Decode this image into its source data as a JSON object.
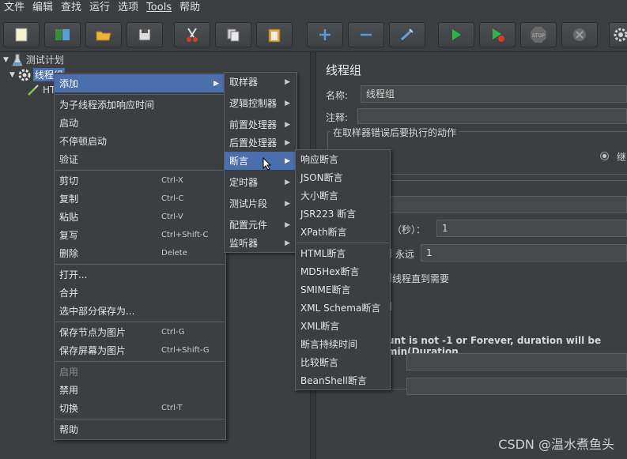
{
  "menubar": [
    "文件",
    "编辑",
    "查找",
    "运行",
    "选项",
    "Tools",
    "帮助"
  ],
  "tree": {
    "plan": "测试计划",
    "thread_group": "线程组",
    "child": "HT"
  },
  "right_panel": {
    "title": "线程组",
    "name_label": "名称:",
    "name_value": "线程组",
    "comment_label": "注释:",
    "error_group_label": "在取样器错误后要执行的动作",
    "radio_partial": "继",
    "seconds_label": "（秒）：",
    "seconds_value": "1",
    "forever_label": "永远",
    "loop_value": "1",
    "thread_need_text": "线程直到需要",
    "duration_note": "unt is not -1 or Forever, duration will be min(Duration,"
  },
  "context_menu": {
    "items": [
      {
        "label": "添加",
        "accel": "",
        "arrow": true,
        "selected": true
      },
      {
        "label": "为子线程添加响应时间",
        "accel": ""
      },
      {
        "label": "启动",
        "accel": ""
      },
      {
        "label": "不停顿启动",
        "accel": ""
      },
      {
        "label": "验证",
        "accel": ""
      },
      {
        "label": "剪切",
        "accel": "Ctrl-X"
      },
      {
        "label": "复制",
        "accel": "Ctrl-C"
      },
      {
        "label": "粘贴",
        "accel": "Ctrl-V"
      },
      {
        "label": "复写",
        "accel": "Ctrl+Shift-C"
      },
      {
        "label": "删除",
        "accel": "Delete"
      },
      {
        "label": "打开...",
        "accel": ""
      },
      {
        "label": "合并",
        "accel": ""
      },
      {
        "label": "选中部分保存为...",
        "accel": ""
      },
      {
        "label": "保存节点为图片",
        "accel": "Ctrl-G"
      },
      {
        "label": "保存屏幕为图片",
        "accel": "Ctrl+Shift-G"
      },
      {
        "label": "启用",
        "accel": "",
        "disabled": true
      },
      {
        "label": "禁用",
        "accel": ""
      },
      {
        "label": "切换",
        "accel": "Ctrl-T"
      },
      {
        "label": "帮助",
        "accel": ""
      }
    ]
  },
  "add_submenu": {
    "items": [
      "取样器",
      "逻辑控制器",
      "前置处理器",
      "后置处理器",
      "断言",
      "定时器",
      "测试片段",
      "配置元件",
      "监听器"
    ],
    "selected": "断言"
  },
  "assertion_submenu": {
    "items": [
      "响应断言",
      "JSON断言",
      "大小断言",
      "JSR223 断言",
      "XPath断言",
      "HTML断言",
      "MD5Hex断言",
      "SMIME断言",
      "XML Schema断言",
      "XML断言",
      "断言持续时间",
      "比较断言",
      "BeanShell断言"
    ]
  },
  "watermark": "CSDN @温水煮鱼头",
  "colors": {
    "background": "#3c3f41",
    "selection": "#4b6eaf",
    "play_green": "#2fb34a"
  },
  "icons": [
    "new-icon",
    "templates-icon",
    "open-icon",
    "save-icon",
    "cut-icon",
    "copy-icon",
    "paste-icon",
    "expand-icon",
    "collapse-icon",
    "toggle-icon",
    "start-icon",
    "start-no-pause-icon",
    "stop-icon",
    "shutdown-icon",
    "gear-icon"
  ]
}
